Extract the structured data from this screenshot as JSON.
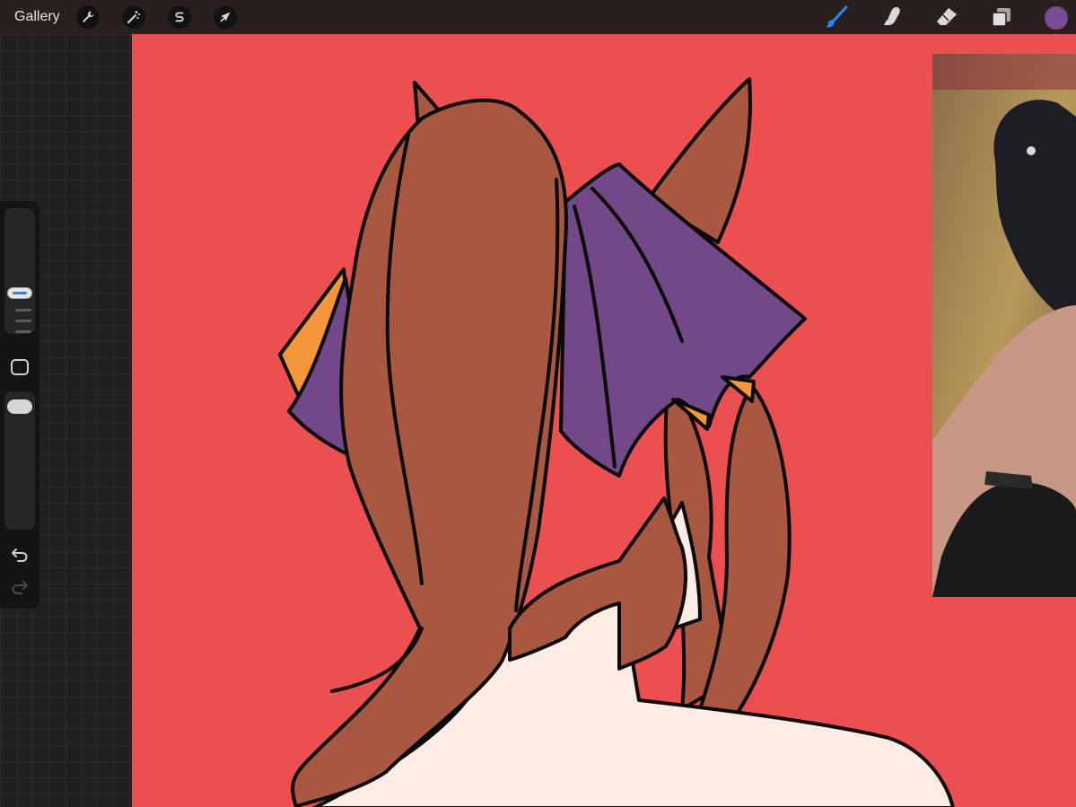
{
  "topbar": {
    "gallery_label": "Gallery",
    "left_tools": [
      {
        "name": "actions",
        "icon": "wrench-icon"
      },
      {
        "name": "adjustments",
        "icon": "magic-wand-icon"
      },
      {
        "name": "selection",
        "icon": "selection-s-icon"
      },
      {
        "name": "transform",
        "icon": "arrow-cursor-icon"
      }
    ],
    "right_tools": [
      {
        "name": "brush",
        "icon": "brush-icon",
        "active": true
      },
      {
        "name": "smudge",
        "icon": "smudge-finger-icon",
        "active": false
      },
      {
        "name": "eraser",
        "icon": "eraser-icon",
        "active": false
      },
      {
        "name": "layers",
        "icon": "layers-icon",
        "active": false
      }
    ],
    "current_color": "#7c4b96"
  },
  "sidebar": {
    "icons": [
      "size-slider",
      "modify-square-icon",
      "opacity-slider",
      "undo-icon",
      "redo-icon"
    ],
    "redo_enabled": false
  },
  "canvas": {
    "background_color": "#ec4f50",
    "hair_color": "#a85840",
    "ribbon_color": "#724888",
    "ribbon_accent_color": "#f4973a",
    "skin_color": "#fdebe4",
    "outline_color": "#0a0a0a"
  },
  "reference_window": {
    "visible": true
  }
}
